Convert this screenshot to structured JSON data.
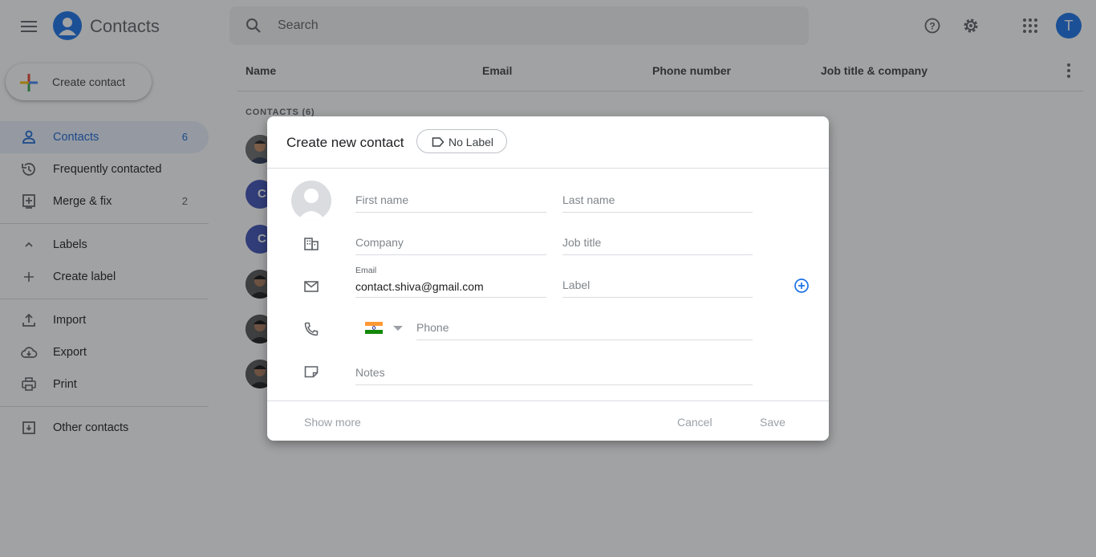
{
  "header": {
    "app_title": "Contacts",
    "search_placeholder": "Search",
    "avatar_letter": "T"
  },
  "sidebar": {
    "create_label": "Create contact",
    "items": [
      {
        "label": "Contacts",
        "count": "6",
        "icon": "person-icon",
        "active": true
      },
      {
        "label": "Frequently contacted",
        "count": "",
        "icon": "history-icon"
      },
      {
        "label": "Merge & fix",
        "count": "2",
        "icon": "merge-icon"
      },
      {
        "label": "Labels",
        "count": "",
        "icon": "chevron-up-icon"
      },
      {
        "label": "Create label",
        "count": "",
        "icon": "plus-icon"
      },
      {
        "label": "Import",
        "count": "",
        "icon": "upload-icon"
      },
      {
        "label": "Export",
        "count": "",
        "icon": "cloud-download-icon"
      },
      {
        "label": "Print",
        "count": "",
        "icon": "print-icon"
      },
      {
        "label": "Other contacts",
        "count": "",
        "icon": "archive-icon"
      }
    ]
  },
  "list": {
    "columns": [
      "Name",
      "Email",
      "Phone number",
      "Job title & company"
    ],
    "section": "CONTACTS (6)",
    "rows": [
      {
        "avatar": "photo"
      },
      {
        "avatar": "C"
      },
      {
        "avatar": "C"
      },
      {
        "avatar": "photo"
      },
      {
        "avatar": "photo"
      },
      {
        "avatar": "photo"
      }
    ]
  },
  "dialog": {
    "title": "Create new contact",
    "label_chip": "No Label",
    "first_name_placeholder": "First name",
    "last_name_placeholder": "Last name",
    "company_placeholder": "Company",
    "job_title_placeholder": "Job title",
    "email_label": "Email",
    "email_value": "contact.shiva@gmail.com",
    "email_type_placeholder": "Label",
    "phone_placeholder": "Phone",
    "notes_placeholder": "Notes",
    "show_more": "Show more",
    "cancel": "Cancel",
    "save": "Save"
  },
  "colors": {
    "accent": "#1a73e8",
    "active_bg": "#e8f0fe",
    "avatar_letter_bg": "#3f51b5"
  }
}
